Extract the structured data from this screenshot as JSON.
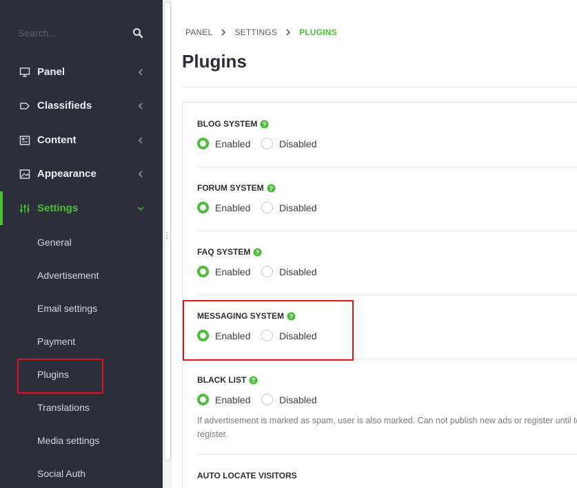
{
  "sidebar": {
    "search_placeholder": "Search...",
    "nav": [
      {
        "label": "Panel",
        "icon": "monitor-icon"
      },
      {
        "label": "Classifieds",
        "icon": "tag-icon"
      },
      {
        "label": "Content",
        "icon": "newspaper-icon"
      },
      {
        "label": "Appearance",
        "icon": "image-icon"
      },
      {
        "label": "Settings",
        "icon": "sliders-icon",
        "active": true
      }
    ],
    "sub_items": [
      "General",
      "Advertisement",
      "Email settings",
      "Payment",
      "Plugins",
      "Translations",
      "Media settings",
      "Social Auth"
    ]
  },
  "breadcrumb": [
    "PANEL",
    "SETTINGS",
    "PLUGINS"
  ],
  "page_title": "Plugins",
  "sections": [
    {
      "title": "BLOG SYSTEM",
      "enabled_label": "Enabled",
      "disabled_label": "Disabled",
      "value": "Enabled"
    },
    {
      "title": "FORUM SYSTEM",
      "enabled_label": "Enabled",
      "disabled_label": "Disabled",
      "value": "Enabled"
    },
    {
      "title": "FAQ SYSTEM",
      "enabled_label": "Enabled",
      "disabled_label": "Disabled",
      "value": "Enabled"
    },
    {
      "title": "MESSAGING SYSTEM",
      "enabled_label": "Enabled",
      "disabled_label": "Disabled",
      "value": "Enabled"
    },
    {
      "title": "BLACK LIST",
      "enabled_label": "Enabled",
      "disabled_label": "Disabled",
      "value": "Enabled",
      "note": "If advertisement is marked as spam, user is also marked. Can not publish new ads or register until to register."
    },
    {
      "title": "AUTO LOCATE VISITORS"
    }
  ],
  "colors": {
    "accent": "#4cbf3a",
    "sidebar_bg": "#2c2f3a",
    "highlight": "#e01414"
  }
}
